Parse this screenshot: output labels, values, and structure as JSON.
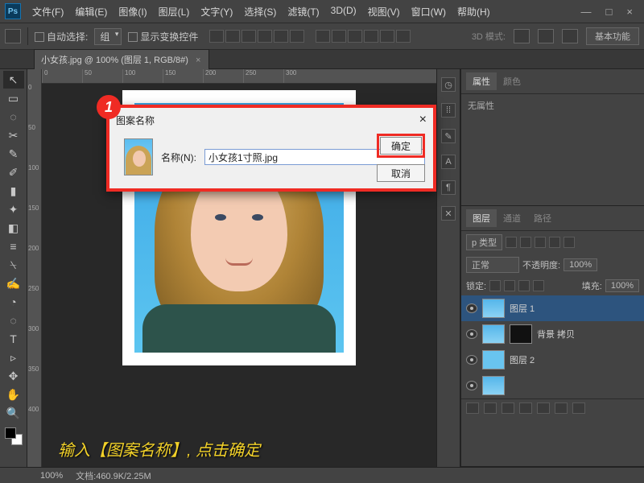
{
  "app": {
    "logo": "Ps"
  },
  "menu": {
    "file": "文件(F)",
    "edit": "编辑(E)",
    "image": "图像(I)",
    "layer": "图层(L)",
    "type": "文字(Y)",
    "select": "选择(S)",
    "filter": "滤镜(T)",
    "three_d": "3D(D)",
    "view": "视图(V)",
    "window": "窗口(W)",
    "help": "帮助(H)"
  },
  "win_controls": {
    "min": "—",
    "max": "□",
    "close": "×"
  },
  "options": {
    "auto_select": "自动选择:",
    "group": "组",
    "show_transform": "显示变换控件",
    "mode3d": "3D 模式:",
    "essentials": "基本功能"
  },
  "doc_tab": {
    "name": "小女孩.jpg @ 100% (图层 1, RGB/8#)",
    "close": "×"
  },
  "ruler_h": [
    "0",
    "50",
    "100",
    "150",
    "200",
    "250",
    "300"
  ],
  "ruler_v": [
    "0",
    "50",
    "100",
    "150",
    "200",
    "250",
    "300",
    "350",
    "400"
  ],
  "panels": {
    "properties_tab": "属性",
    "color_tab": "颜色",
    "no_props": "无属性",
    "layers_tab": "图层",
    "channels_tab": "通道",
    "paths_tab": "路径",
    "kind": "p 类型",
    "blend_mode": "正常",
    "opacity_label": "不透明度:",
    "opacity_value": "100%",
    "lock_label": "锁定:",
    "fill_label": "填充:",
    "fill_value": "100%",
    "layer1": "图层 1",
    "layer_bg_copy": "背景 拷贝",
    "layer2": "图层 2"
  },
  "dialog": {
    "title": "图案名称",
    "name_label": "名称(N):",
    "name_value": "小女孩1寸照.jpg",
    "ok": "确定",
    "cancel": "取消",
    "close": "×"
  },
  "step_badge": "1",
  "caption": "输入【图案名称】, 点击确定",
  "status": {
    "zoom": "100%",
    "docinfo": "文档:460.9K/2.25M"
  },
  "tools": [
    "↖",
    "▭",
    "◌",
    "✂",
    "✎",
    "✐",
    "▮",
    "✦",
    "◧",
    "≡",
    "⍀",
    "✍",
    "◔",
    "◌",
    "●",
    "✎",
    "T",
    "▹",
    "✥",
    "✋",
    "🔍"
  ]
}
